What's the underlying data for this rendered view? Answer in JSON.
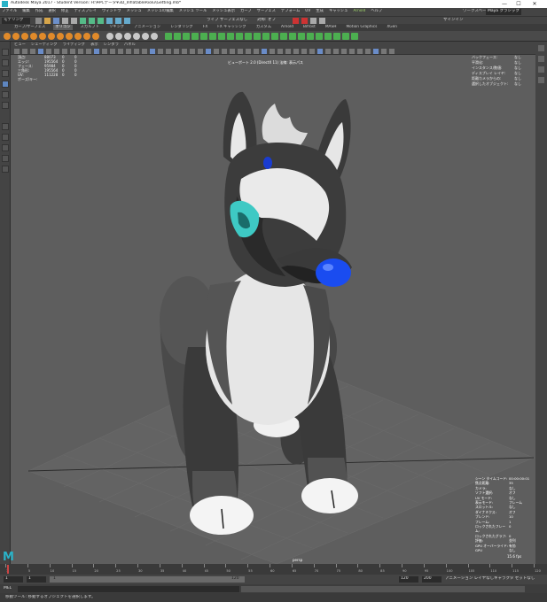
{
  "window": {
    "title": "Autodesk Maya 2017 - Student Version: H:\\¥PCデータ¥3D_InflatableRiolu\\Getting.mb*",
    "min": "—",
    "max": "☐",
    "close": "✕"
  },
  "menubar": [
    "ファイル",
    "編集",
    "作成",
    "選択",
    "修正",
    "ディスプレイ",
    "ウィンドウ",
    "メッシュ",
    "メッシュの編集",
    "メッシュ ツール",
    "メッシュ表示",
    "カーブ",
    "サーフェス",
    "デフォーム",
    "UV",
    "生成",
    "キャッシュ",
    "Arnold",
    "ヘルプ"
  ],
  "workspace": {
    "label": "ワークスペース:",
    "value": "Maya クラシック"
  },
  "statusline": {
    "mode": "モデリング",
    "live": "ライブ サーフェスなし",
    "sym": "対称: オフ",
    "login": "サインイン"
  },
  "shelf_tabs": [
    {
      "label": "カーブ/サーフェス",
      "active": false
    },
    {
      "label": "ポリゴン",
      "active": true
    },
    {
      "label": "スカルプト",
      "active": false
    },
    {
      "label": "リギング",
      "active": false
    },
    {
      "label": "アニメーション",
      "active": false
    },
    {
      "label": "レンダリング",
      "active": false
    },
    {
      "label": "FX",
      "active": false
    },
    {
      "label": "FX キャッシング",
      "active": false
    },
    {
      "label": "カスタム",
      "active": false
    },
    {
      "label": "Arnold",
      "active": false
    },
    {
      "label": "Bifrost",
      "active": false
    },
    {
      "label": "MASH",
      "active": false
    },
    {
      "label": "Motion Graphics",
      "active": false
    },
    {
      "label": "XGen",
      "active": false
    }
  ],
  "panel_menu": [
    "ビュー",
    "シェーディング",
    "ライティング",
    "表示",
    "レンダラ",
    "パネル"
  ],
  "hud_left": {
    "rows": [
      [
        "頂点:",
        "88073",
        "0",
        "0"
      ],
      [
        "エッジ:",
        "195564",
        "0",
        "0"
      ],
      [
        "フェース:",
        "95984",
        "0",
        "0"
      ],
      [
        "三角形:",
        "195564",
        "0",
        "0"
      ],
      [
        "UV:",
        "111228",
        "0",
        "0"
      ],
      [
        "ポーズ/キー:",
        "",
        "",
        ""
      ]
    ]
  },
  "hud_center": "ビューポート 2.0 (DirectX 11) 法線: 表示パス",
  "hud_right": {
    "rows": [
      [
        "バックフェース:",
        "なし"
      ],
      [
        "平滑化:",
        "なし"
      ],
      [
        "インスタンス/数値:",
        "なし"
      ],
      [
        "ディスプレイ レイヤ:",
        "なし"
      ],
      [
        "距離カメラからの:",
        "なし"
      ],
      [
        "選択したオブジェクト:",
        "なし"
      ]
    ]
  },
  "hud_bottom_right": {
    "rows": [
      [
        "シーン タイムコード:",
        "00:00:00:01"
      ],
      [
        "焦点距離:",
        "35"
      ],
      [
        "カメラ:",
        "なし"
      ],
      [
        "ソフト選択:",
        "オフ"
      ],
      [
        "UV モード:",
        "なし"
      ],
      [
        "表示モード:",
        "フレーム"
      ],
      [
        "スロットル:",
        "なし"
      ],
      [
        "ダイナミクス:",
        "オフ"
      ],
      [
        "ブレンド:",
        "10"
      ],
      [
        "フレーム:",
        "1"
      ],
      [
        "ロックされたフレーム:",
        "0"
      ],
      [
        "ロックされたグラフ:",
        "0"
      ],
      [
        "評価:",
        "並列"
      ],
      [
        "GPU オーバーライド:",
        "有効"
      ],
      [
        "GPU",
        "なし"
      ]
    ],
    "fps": "15.6 fps"
  },
  "camera_label": "persp",
  "timeline": {
    "ticks": [
      "1",
      "5",
      "10",
      "15",
      "20",
      "25",
      "30",
      "35",
      "40",
      "45",
      "50",
      "55",
      "60",
      "65",
      "70",
      "75",
      "80",
      "85",
      "90",
      "95",
      "100",
      "105",
      "110",
      "115",
      "120"
    ],
    "current": "1"
  },
  "range": {
    "start": "1",
    "start2": "1",
    "mid": "120",
    "end1": "120",
    "end2": "200",
    "no_layer": "アニメーション レイヤなし",
    "no_char": "キャラクタ セットなし"
  },
  "cmd": {
    "label": "MEL"
  },
  "help": {
    "text": "移動ツール: 移動するオブジェクトを選択します。"
  },
  "colors": {
    "viewport": "#5e5e5e",
    "panel": "#444444",
    "accent": "#2ab3c8",
    "nose": "#1a4cf0",
    "eye": "#3ec9c4"
  }
}
